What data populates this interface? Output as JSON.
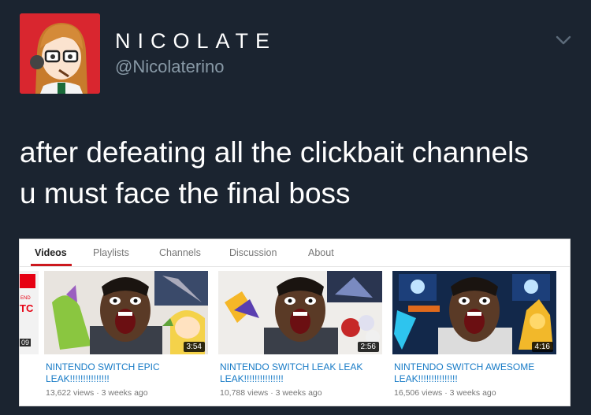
{
  "tweet": {
    "display_name": "NICOLATE",
    "handle": "@Nicolaterino",
    "text_line1": "after defeating all the clickbait channels",
    "text_line2": "u must face the final boss"
  },
  "icons": {
    "avatar": "anime-avatar",
    "menu": "chevron-down-icon"
  },
  "colors": {
    "background": "#1b2430",
    "handle": "#8899a6",
    "link": "#167ac6",
    "tab_accent": "#cc181e"
  },
  "youtube": {
    "tabs": [
      {
        "label": "Videos"
      },
      {
        "label": "Playlists"
      },
      {
        "label": "Channels"
      },
      {
        "label": "Discussion"
      },
      {
        "label": "About"
      }
    ],
    "partial": {
      "top_text": "END",
      "side_text": "TC",
      "duration": "09"
    },
    "videos": [
      {
        "duration": "3:54",
        "title_line1": "NINTENDO SWITCH EPIC",
        "title_line2": "LEAK!!!!!!!!!!!!!!!",
        "views": "13,622 views",
        "age": "3 weeks ago"
      },
      {
        "duration": "2:56",
        "title_line1": "NINTENDO SWITCH LEAK LEAK",
        "title_line2": "LEAK!!!!!!!!!!!!!!!",
        "views": "10,788 views",
        "age": "3 weeks ago"
      },
      {
        "duration": "4:16",
        "title_line1": "NINTENDO SWITCH AWESOME",
        "title_line2": "LEAK!!!!!!!!!!!!!!!",
        "views": "16,506 views",
        "age": "3 weeks ago"
      }
    ],
    "separator": "·"
  }
}
